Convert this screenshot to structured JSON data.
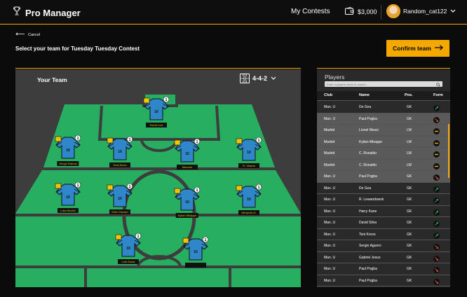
{
  "header": {
    "app_title": "Pro Manager",
    "nav_contests": "My Contests",
    "wallet_amount": "$3,000",
    "username": "Random_cat122"
  },
  "page": {
    "back_label": "Cancel",
    "title": "Select your team for Tuesday Tuesday Contest",
    "confirm_label": "Confirm team"
  },
  "team": {
    "title": "Your Team",
    "formation": "4-4-2",
    "players": [
      {
        "name": "David Luiz",
        "jersey": "10",
        "badge": "1"
      },
      {
        "name": "Sergio Ramos",
        "jersey": "10",
        "badge": "1"
      },
      {
        "name": "Dani Alves",
        "jersey": "10",
        "badge": "1"
      },
      {
        "name": "Marcelo",
        "jersey": "10",
        "badge": "1"
      },
      {
        "name": "R. Varane",
        "jersey": "10",
        "badge": "1"
      },
      {
        "name": "Luka Modric",
        "jersey": "10",
        "badge": "1"
      },
      {
        "name": "Eden Hazard",
        "jersey": "10",
        "badge": "1"
      },
      {
        "name": "Kylian Mbappe",
        "jersey": "10",
        "badge": "1"
      },
      {
        "name": "Memphis D.",
        "jersey": "10",
        "badge": "1"
      },
      {
        "name": "Luis Suraz",
        "jersey": "10",
        "badge": "1"
      },
      {
        "name": "",
        "jersey": "10",
        "badge": "1"
      }
    ]
  },
  "players_list": {
    "title": "Players",
    "search_placeholder": "Enter a players name to search...",
    "columns": {
      "club": "Club",
      "name": "Name",
      "pos": "Pos.",
      "form": "Form"
    },
    "rows": [
      {
        "club": "Man. U",
        "name": "De Gea",
        "pos": "GK",
        "trend": "up",
        "selected": false
      },
      {
        "club": "Man. U",
        "name": "Paul Pogba",
        "pos": "GK",
        "trend": "down",
        "selected": true
      },
      {
        "club": "Madrid",
        "name": "Lionel Messi",
        "pos": "LW",
        "trend": "flat",
        "selected": true
      },
      {
        "club": "Madrid",
        "name": "Kylian Mbappe",
        "pos": "LW",
        "trend": "flat",
        "selected": true
      },
      {
        "club": "Madrid",
        "name": "C. Ronaldo",
        "pos": "LW",
        "trend": "flat",
        "selected": true
      },
      {
        "club": "Madrid",
        "name": "C. Ronaldo",
        "pos": "LW",
        "trend": "flat",
        "selected": true
      },
      {
        "club": "Man. U",
        "name": "Paul Pogba",
        "pos": "GK",
        "trend": "down",
        "selected": true
      },
      {
        "club": "Man. U",
        "name": "De Gea",
        "pos": "GK",
        "trend": "up",
        "selected": false
      },
      {
        "club": "Man. U",
        "name": "R. Lewandowsk",
        "pos": "GK",
        "trend": "up",
        "selected": false
      },
      {
        "club": "Man. U",
        "name": "Harry Kane",
        "pos": "GK",
        "trend": "up",
        "selected": false
      },
      {
        "club": "Man. U",
        "name": "David Silva",
        "pos": "GK",
        "trend": "up",
        "selected": false
      },
      {
        "club": "Man. U",
        "name": "Toni Kroos",
        "pos": "GK",
        "trend": "up",
        "selected": false
      },
      {
        "club": "Man. U",
        "name": "Sergio Aguero",
        "pos": "GK",
        "trend": "down",
        "selected": false
      },
      {
        "club": "Man. U",
        "name": "Gabriel Jesus",
        "pos": "GK",
        "trend": "down",
        "selected": false
      },
      {
        "club": "Man. U",
        "name": "Paul Pogba",
        "pos": "GK",
        "trend": "down",
        "selected": false
      },
      {
        "club": "Man. U",
        "name": "Paul Pogba",
        "pos": "GK",
        "trend": "down",
        "selected": false
      }
    ]
  },
  "colors": {
    "accent": "#f5a800",
    "pitch_green": "#27ae60",
    "pitch_lines": "#3d3d3d",
    "jersey_blue": "#2f86c8",
    "trend_up": "#27ae60",
    "trend_down": "#e74c3c",
    "trend_flat": "#f5a800"
  },
  "icons": {
    "logo": "trophy-icon",
    "wallet": "wallet-icon",
    "back": "arrow-left-icon",
    "confirm": "arrow-right-icon",
    "formation": "formation-icon",
    "search": "search-icon"
  }
}
